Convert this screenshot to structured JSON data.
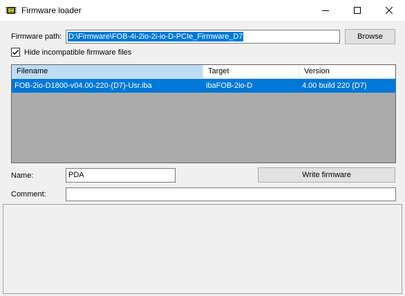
{
  "window": {
    "title": "Firmware loader"
  },
  "firmware_path": {
    "label": "Firmware path:",
    "value": "D:\\Firmware\\FOB-4i-2io-2i-io-D-PCIe_Firmware_D7",
    "browse_label": "Browse"
  },
  "filter": {
    "label": "Hide incompatible firmware files",
    "checked": true
  },
  "table": {
    "columns": [
      "Filename",
      "Target",
      "Version"
    ],
    "rows": [
      {
        "filename": "FOB-2io-D1800-v04.00-220-(D7)-Usr.iba",
        "target": "ibaFOB-2io-D",
        "version": "4.00 build 220 (D7)"
      }
    ]
  },
  "name": {
    "label": "Name:",
    "value": "PDA"
  },
  "write_button": {
    "label": "Write firmware"
  },
  "comment": {
    "label": "Comment:",
    "value": ""
  },
  "colors": {
    "selection": "#0078d7",
    "header_selected": "#bcdcf4",
    "grid_background": "#ababab"
  }
}
